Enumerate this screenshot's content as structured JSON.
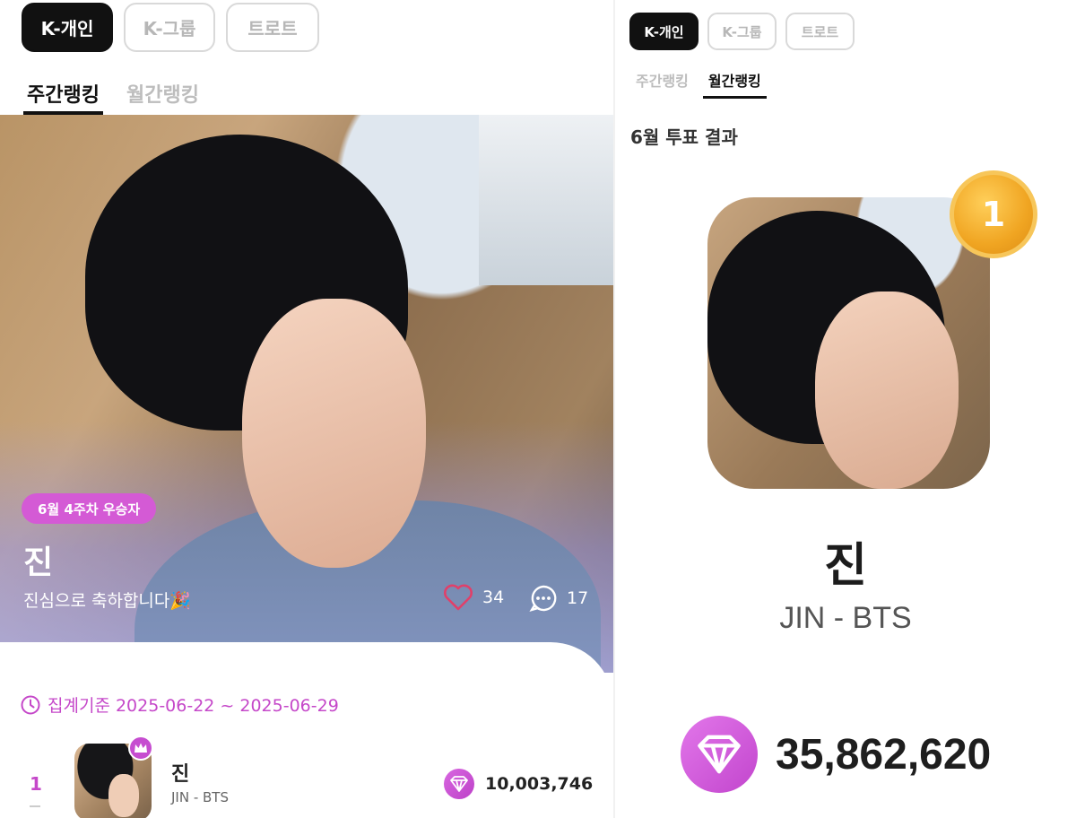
{
  "left": {
    "categories": [
      "K-개인",
      "K-그룹",
      "트로트"
    ],
    "tabs": [
      "주간랭킹",
      "월간랭킹"
    ],
    "hero": {
      "badge": "6월 4주차 우승자",
      "name": "진",
      "message": "진심으로 축하합니다🎉",
      "likes": "34",
      "comments": "17"
    },
    "period_label": "집계기준 2025-06-22 ~ 2025-06-29",
    "ranking": [
      {
        "rank": "1",
        "name": "진",
        "group": "JIN - BTS",
        "votes": "10,003,746"
      }
    ]
  },
  "right": {
    "categories": [
      "K-개인",
      "K-그룹",
      "트로트"
    ],
    "tabs": [
      "주간랭킹",
      "월간랭킹"
    ],
    "result_title": "6월 투표 결과",
    "rank": "1",
    "name": "진",
    "group": "JIN - BTS",
    "votes": "35,862,620"
  },
  "colors": {
    "accent": "#c548c9",
    "badge": "#d45ad5",
    "medal": "#f0a522",
    "active_chip": "#111111"
  },
  "icons": [
    "clock-icon",
    "heart-icon",
    "comment-icon",
    "crown-icon",
    "vote-gem-icon",
    "first-place-medal-icon"
  ]
}
